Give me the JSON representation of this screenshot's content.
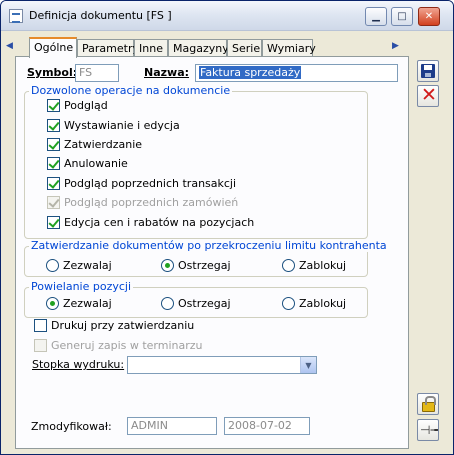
{
  "window": {
    "title": "Definicja dokumentu [FS ]"
  },
  "titlebar_buttons": {
    "minimize": "▁",
    "maximize": "□",
    "close": "✕"
  },
  "tabs": [
    {
      "label": "Ogólne",
      "active": true
    },
    {
      "label": "Parametry",
      "active": false
    },
    {
      "label": "Inne",
      "active": false
    },
    {
      "label": "Magazyny",
      "active": false
    },
    {
      "label": "Serie",
      "active": false
    },
    {
      "label": "Wymiary",
      "active": false
    }
  ],
  "tab_arrows": {
    "left": "◀",
    "right": "▶"
  },
  "header": {
    "symbol_label": "Symbol:",
    "symbol_value": "FS",
    "name_label": "Nazwa:",
    "name_value": "Faktura sprzedaży"
  },
  "allowed_ops": {
    "title": "Dozwolone operacje na dokumencie",
    "items": [
      {
        "label": "Podgląd",
        "checked": true,
        "disabled": false
      },
      {
        "label": "Wystawianie i edycja",
        "checked": true,
        "disabled": false
      },
      {
        "label": "Zatwierdzanie",
        "checked": true,
        "disabled": false
      },
      {
        "label": "Anulowanie",
        "checked": true,
        "disabled": false
      },
      {
        "label": "Podgląd poprzednich transakcji",
        "checked": true,
        "disabled": false
      },
      {
        "label": "Podgląd poprzednich zamówień",
        "checked": true,
        "disabled": true
      },
      {
        "label": "Edycja cen i rabatów na pozycjach",
        "checked": true,
        "disabled": false
      }
    ]
  },
  "limit_approval": {
    "title": "Zatwierdzanie dokumentów po przekroczeniu limitu kontrahenta",
    "options": [
      "Zezwalaj",
      "Ostrzegaj",
      "Zablokuj"
    ],
    "selected": "Ostrzegaj"
  },
  "duplicate_items": {
    "title": "Powielanie pozycji",
    "options": [
      "Zezwalaj",
      "Ostrzegaj",
      "Zablokuj"
    ],
    "selected": "Zezwalaj"
  },
  "print_on_approve": {
    "label": "Drukuj przy zatwierdzaniu",
    "checked": false
  },
  "terminal_save": {
    "label": "Generuj zapis w terminarzu",
    "checked": false,
    "disabled": true
  },
  "footer_print": {
    "label": "Stopka wydruku:",
    "value": ""
  },
  "modified": {
    "label": "Zmodyfikował:",
    "user": "ADMIN",
    "date": "2008-07-02"
  },
  "colors": {
    "accent_tab": "#e68b2c",
    "group_title": "#0046d5",
    "check": "#21a121"
  }
}
